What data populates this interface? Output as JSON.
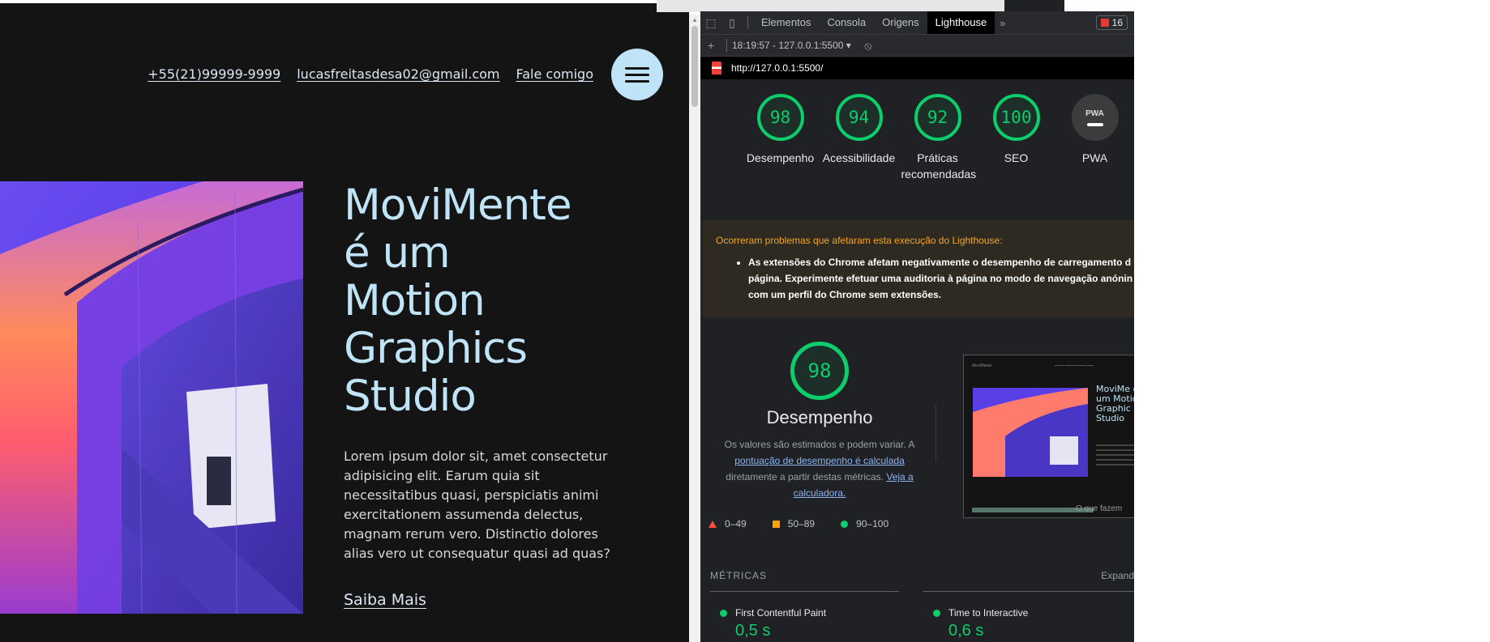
{
  "site": {
    "nav": {
      "phone": "+55(21)99999-9999",
      "email": "lucasfreitasdesa02@gmail.com",
      "contact": "Fale comigo"
    },
    "menu_icon": "hamburger-icon",
    "hero": {
      "title_lines": [
        "MoviMente",
        "é um",
        "Motion",
        "Graphics",
        "Studio"
      ],
      "text": "Lorem ipsum dolor sit, amet consectetur adipisicing elit. Earum quia sit necessitatibus quasi, perspiciatis animi exercitationem assumenda delectus, magnam rerum vero. Distinctio dolores alias vero ut consequatur quasi ad quas?",
      "link": "Saiba Mais"
    },
    "colors": {
      "background": "#141414",
      "accent": "#bfe3f7"
    }
  },
  "devtools": {
    "tabs": [
      "Elementos",
      "Consola",
      "Origens",
      "Lighthouse"
    ],
    "active_tab": "Lighthouse",
    "issues_count": "16",
    "report_selector": "18:19:57 - 127.0.0.1:5500",
    "url": "http://127.0.0.1:5500/",
    "scores": [
      {
        "value": "98",
        "label": "Desempenho"
      },
      {
        "value": "94",
        "label": "Acessibilidade"
      },
      {
        "value": "92",
        "label": "Práticas recomendadas"
      },
      {
        "value": "100",
        "label": "SEO"
      }
    ],
    "pwa": {
      "label": "PWA",
      "badge": "PWA"
    },
    "warning": {
      "title": "Ocorreram problemas que afetaram esta execução do Lighthouse:",
      "item": "As extensões do Chrome afetam negativamente o desempenho de carregamento d página. Experimente efetuar uma auditoria à página no modo de navegação anónin com um perfil do Chrome sem extensões."
    },
    "performance": {
      "score": "98",
      "title": "Desempenho",
      "desc_1": "Os valores são estimados e podem variar. A",
      "link_1": "pontuação de desempenho é calculada",
      "desc_2": "diretamente a partir destas métricas.",
      "link_2": "Veja a calculadora."
    },
    "legend": [
      "0–49",
      "50–89",
      "90–100"
    ],
    "metrics_heading": "MÉTRICAS",
    "expand_label": "Expand",
    "metrics": [
      {
        "label": "First Contentful Paint",
        "value": "0,5 s"
      },
      {
        "label": "Time to Interactive",
        "value": "0,6 s"
      }
    ],
    "thumbnail": {
      "logo": "MoviMente",
      "title": "MoviMe é um Motion Graphic Studio",
      "tail": "O que fazem"
    },
    "score_color": "#0cce6b"
  }
}
